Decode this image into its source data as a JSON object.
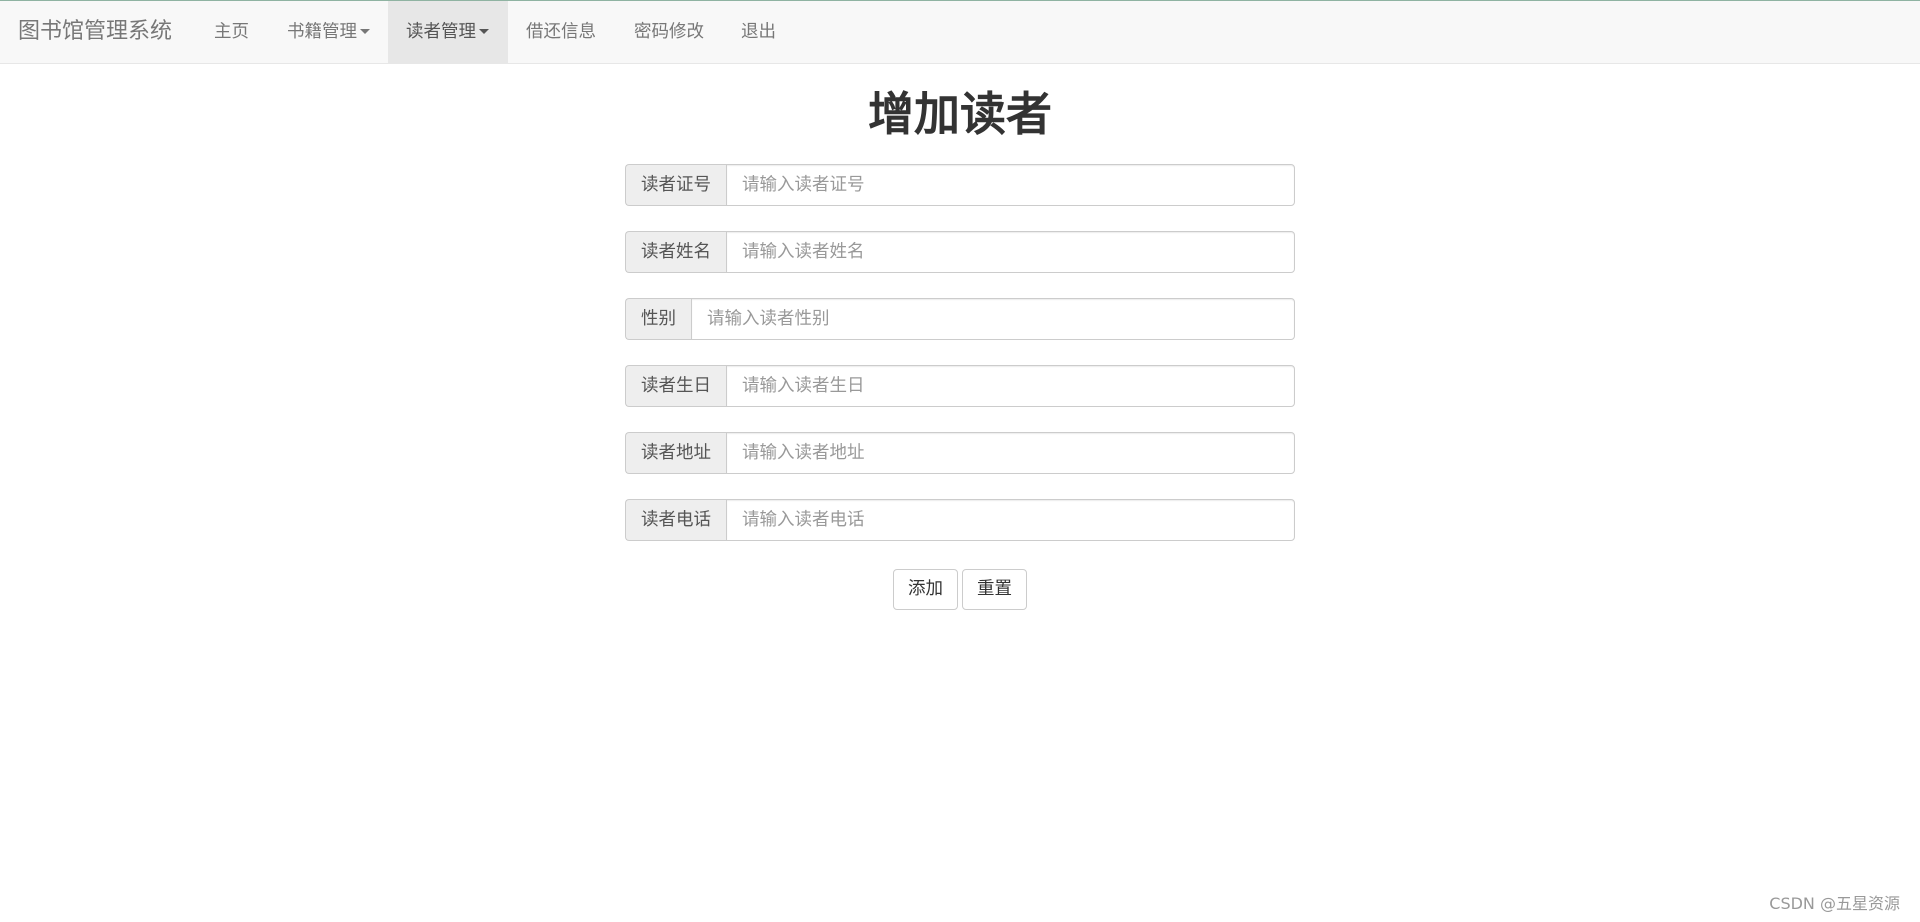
{
  "navbar": {
    "brand": "图书馆管理系统",
    "items": [
      {
        "label": "主页",
        "dropdown": false,
        "active": false
      },
      {
        "label": "书籍管理",
        "dropdown": true,
        "active": false
      },
      {
        "label": "读者管理",
        "dropdown": true,
        "active": true
      },
      {
        "label": "借还信息",
        "dropdown": false,
        "active": false
      },
      {
        "label": "密码修改",
        "dropdown": false,
        "active": false
      },
      {
        "label": "退出",
        "dropdown": false,
        "active": false
      }
    ]
  },
  "page": {
    "title": "增加读者"
  },
  "form": {
    "fields": [
      {
        "label": "读者证号",
        "value": "",
        "placeholder": "请输入读者证号"
      },
      {
        "label": "读者姓名",
        "value": "",
        "placeholder": "请输入读者姓名"
      },
      {
        "label": "性别",
        "value": "",
        "placeholder": "请输入读者性别"
      },
      {
        "label": "读者生日",
        "value": "",
        "placeholder": "请输入读者生日"
      },
      {
        "label": "读者地址",
        "value": "",
        "placeholder": "请输入读者地址"
      },
      {
        "label": "读者电话",
        "value": "",
        "placeholder": "请输入读者电话"
      }
    ],
    "submit_label": "添加",
    "reset_label": "重置"
  },
  "watermark": "CSDN @五星资源",
  "colors": {
    "navbar_bg": "#f8f8f8",
    "navbar_active_bg": "#e7e7e7",
    "nav_text": "#777777",
    "addon_bg": "#eeeeee",
    "border": "#cccccc",
    "title_text": "#333333"
  }
}
